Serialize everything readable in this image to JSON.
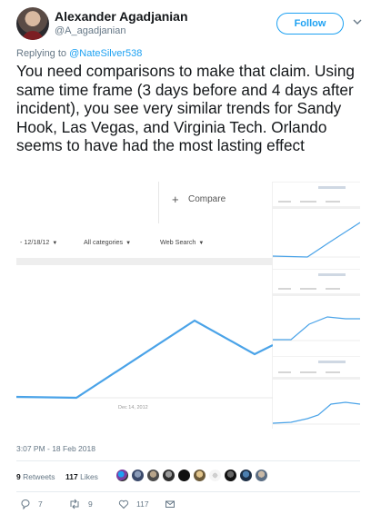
{
  "tweet": {
    "display_name": "Alexander Agadjanian",
    "handle": "@A_agadjanian",
    "follow_label": "Follow",
    "reply_prefix": "Replying to",
    "reply_mention": "@NateSilver538",
    "text": "You need comparisons to make that claim. Using same time frame (3 days before and 4 days after incident), you see very similar trends for Sandy Hook, Las Vegas, and Virginia Tech. Orlando seems to have had the most lasting effect",
    "timestamp": "3:07 PM - 18 Feb 2018",
    "retweets_count": "9",
    "retweets_label": "Retweets",
    "likes_count": "117",
    "likes_label": "Likes",
    "actions": {
      "reply_count": "7",
      "retweet_count": "9",
      "like_count": "117"
    }
  },
  "media": {
    "compare_label": "Compare",
    "filters": {
      "date": "- 12/18/12",
      "category": "All categories",
      "source": "Web Search"
    },
    "x_axis_label": "Dec 14, 2012"
  },
  "colors": {
    "accent": "#1da1f2",
    "chart_line": "#4aa3e8",
    "muted_text": "#657786"
  },
  "icons": [
    "avatar",
    "chevron-down-icon",
    "reply-icon",
    "retweet-icon",
    "like-icon",
    "message-icon"
  ]
}
